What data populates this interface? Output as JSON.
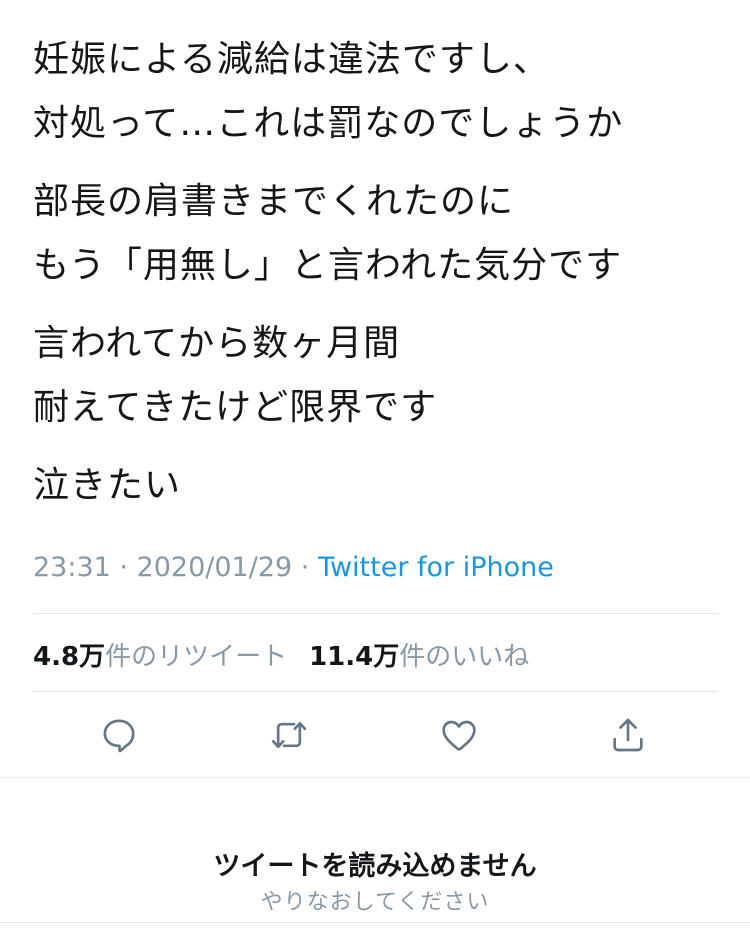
{
  "tweet": {
    "paragraphs": [
      [
        "妊娠による減給は違法ですし、",
        "対処って…これは罰なのでしょうか"
      ],
      [
        "部長の肩書きまでくれたのに",
        "もう「用無し」と言われた気分です"
      ],
      [
        "言われてから数ヶ月間",
        "耐えてきたけど限界です"
      ],
      [
        "泣きたい"
      ]
    ],
    "time": "23:31",
    "separator1": " · ",
    "date": "2020/01/29",
    "separator2": " · ",
    "source": "Twitter for iPhone"
  },
  "stats": {
    "retweets_value": "4.8万",
    "retweets_label": "件のリツイート",
    "likes_value": "11.4万",
    "likes_label": "件のいいね"
  },
  "actions": {
    "reply_icon": "reply-icon",
    "retweet_icon": "retweet-icon",
    "like_icon": "heart-icon",
    "share_icon": "share-icon",
    "icon_color": "#657786"
  },
  "load_error": {
    "title": "ツイートを読み込めません",
    "retry": "やりなおしてください"
  },
  "colors": {
    "text": "#14171a",
    "muted": "#8899a6",
    "link": "#1b95e0",
    "divider": "#e1e8ed"
  }
}
